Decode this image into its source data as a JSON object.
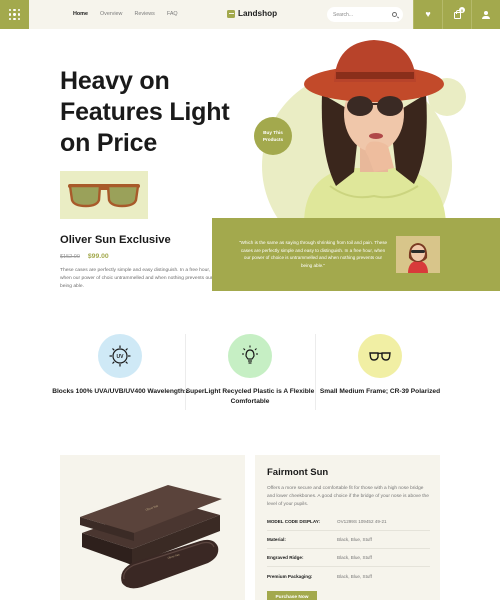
{
  "nav": {
    "links": [
      "Home",
      "Overview",
      "Reviews",
      "FAQ"
    ],
    "brand": "Landshop",
    "search_placeholder": "Search...",
    "cart_count": "0"
  },
  "hero": {
    "title": "Heavy on Features Light on Price",
    "badge": "Buy This Products",
    "product_name": "Oliver Sun Exclusive",
    "old_price": "$152.00",
    "new_price": "$99.00",
    "description": "These cases are perfectly simple and easy distinguish. In a free hour, when our power of choic untrammelled and when nothing prevents our being able.",
    "quote": "\"Which is the same as saying through shrinking from toil and pain. These cases are perfectly simple and easy to distinguish. In a free hour, when our power of choice is untrammelled and when nothing prevents our being able.\""
  },
  "features": [
    {
      "text": "Blocks 100% UVA/UVB/UV400 Wavelengths",
      "icon": "uv-icon"
    },
    {
      "text": "SuperLight Recycled Plastic is A Flexible Comfortable",
      "icon": "lightbulb-icon"
    },
    {
      "text": "Small Medium Frame; CR-39 Polarized",
      "icon": "glasses-icon"
    }
  ],
  "product": {
    "title": "Fairmont Sun",
    "description": "Offers a more secure and comfortable fit for those with a high nose bridge and lower cheekbones. A good choice if the bridge of your nose is above the level of your pupils.",
    "specs": [
      {
        "key": "MODEL CODE DISPLAY:",
        "value": "OV1299S 109452 49-21"
      },
      {
        "key": "Material:",
        "value": "Black, Blue, Stuff"
      },
      {
        "key": "Engraved Ridge:",
        "value": "Black, Blue, Stuff"
      },
      {
        "key": "Premium Packaging:",
        "value": "Black, Blue, Stuff"
      }
    ],
    "buy_label": "Purchase Now"
  },
  "colors": {
    "accent": "#a3a94d",
    "accent_light": "#eaedc4",
    "panel": "#f6f4ec",
    "hat": "#c24a2a"
  }
}
